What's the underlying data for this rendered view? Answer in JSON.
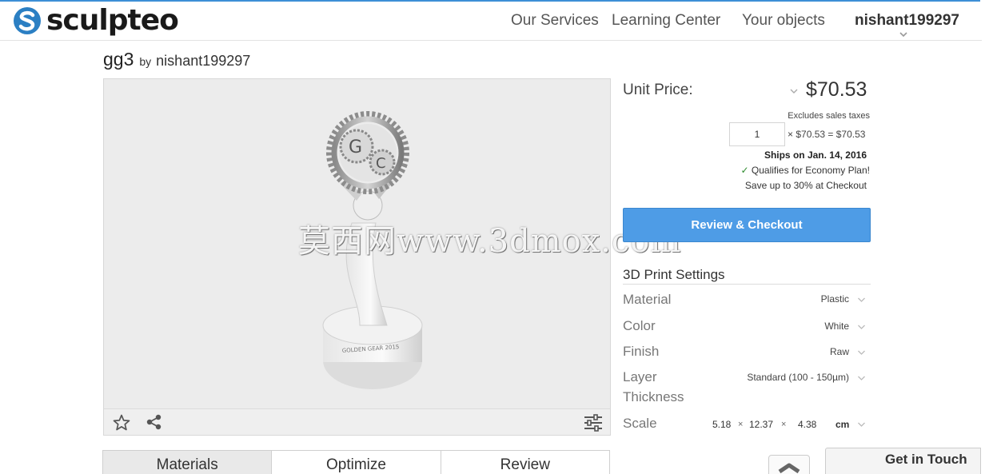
{
  "header": {
    "logo_text": "sculpteo",
    "nav": [
      "Our Services",
      "Learning Center",
      "Your objects"
    ],
    "user": "nishant199297"
  },
  "object": {
    "title": "gg3",
    "by_label": "by",
    "author": "nishant199297"
  },
  "viewer": {
    "watermark": "莫西网www.3dmox.com",
    "toolbar_icons": [
      "star-icon",
      "share-icon",
      "settings-sliders-icon"
    ]
  },
  "tabs": [
    "Materials",
    "Optimize",
    "Review"
  ],
  "pricing": {
    "unit_label": "Unit Price:",
    "price": "$70.53",
    "taxes_note": "Excludes sales taxes",
    "quantity": "1",
    "calc": "× $70.53 = $70.53",
    "ships": "Ships on Jan. 14, 2016",
    "economy": "Qualifies for Economy Plan!",
    "save_note": "Save up to 30% at Checkout",
    "checkout_button": "Review & Checkout"
  },
  "settings": {
    "title": "3D Print Settings",
    "material": {
      "label": "Material",
      "value": "Plastic"
    },
    "color": {
      "label": "Color",
      "value": "White"
    },
    "finish": {
      "label": "Finish",
      "value": "Raw"
    },
    "layer": {
      "label_line1": "Layer",
      "label_line2": "Thickness",
      "value": "Standard (100 - 150µm)"
    },
    "scale": {
      "label": "Scale",
      "x": "5.18",
      "y": "12.37",
      "z": "4.38",
      "sep": "×",
      "unit": "cm"
    }
  },
  "widgets": {
    "get_in_touch": "Get in Touch"
  },
  "colors": {
    "accent": "#4e9ce6",
    "top_line": "#3d8fd6",
    "logo_blue": "#2b7fc3"
  }
}
